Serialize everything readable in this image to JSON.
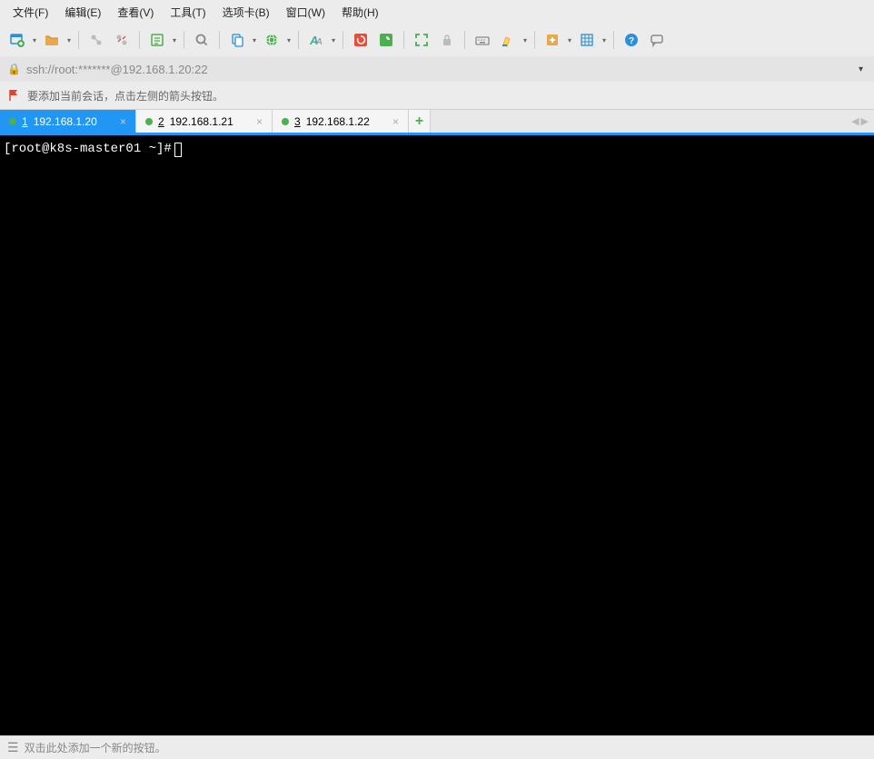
{
  "menubar": {
    "file": "文件(F)",
    "edit": "编辑(E)",
    "view": "查看(V)",
    "tools": "工具(T)",
    "options": "选项卡(B)",
    "window": "窗口(W)",
    "help": "帮助(H)"
  },
  "addressbar": {
    "url": "ssh://root:*******@192.168.1.20:22"
  },
  "hint": {
    "text": "要添加当前会话，点击左侧的箭头按钮。"
  },
  "tabs": [
    {
      "num": "1",
      "label": "192.168.1.20",
      "active": true
    },
    {
      "num": "2",
      "label": "192.168.1.21",
      "active": false
    },
    {
      "num": "3",
      "label": "192.168.1.22",
      "active": false
    }
  ],
  "terminal": {
    "prompt": "[root@k8s-master01 ~]# "
  },
  "statusbar": {
    "hint": "双击此处添加一个新的按钮。"
  },
  "colors": {
    "accent": "#2196f3",
    "green": "#4caf50",
    "orange": "#e88b2e",
    "red": "#d43"
  }
}
